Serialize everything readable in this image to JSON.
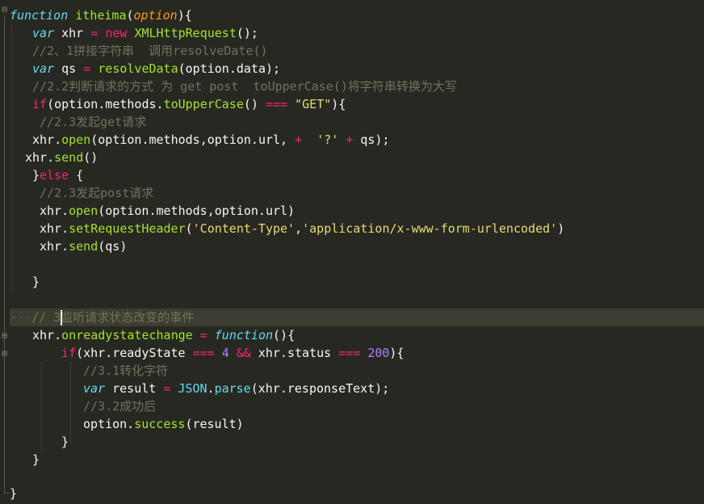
{
  "editor": {
    "theme": "monokai",
    "colors": {
      "background": "#272822",
      "keyword": "#f92672",
      "storage": "#66d9ef",
      "function": "#a6e22e",
      "string": "#e6db74",
      "number": "#ae81ff",
      "comment": "#75715e",
      "parameter": "#fd971f",
      "text": "#f8f8f2"
    },
    "lines": {
      "l1": {
        "kw": "function",
        "name": "itheima",
        "open": "(",
        "param": "option",
        "close": "){"
      },
      "l2": {
        "kw": "var",
        "a": " xhr ",
        "eq": "=",
        "new": "new",
        "cls": "XMLHttpRequest",
        "end": "();"
      },
      "l3": {
        "comment": "//2、1拼接字符串  调用resolveDate()"
      },
      "l4": {
        "kw": "var",
        "a": " qs ",
        "eq": "=",
        "fn": "resolveData",
        "end": "(option.data);"
      },
      "l5": {
        "comment": "//2.2判断请求的方式 为 get post  toUpperCase()将字符串转换为大写"
      },
      "l6": {
        "kw": "if",
        "a": "(option.methods.",
        "fn": "toUpperCase",
        "b": "() ",
        "op": "===",
        "c": " ",
        "str": "\"GET\"",
        "end": "){"
      },
      "l7": {
        "comment": "//2.3发起get请求"
      },
      "l8": {
        "a": "xhr.",
        "fn": "open",
        "b": "(option.methods,option.url, ",
        "op1": "+",
        "c": "  ",
        "str": "'?'",
        "d": " ",
        "op2": "+",
        "end": " qs);"
      },
      "l9": {
        "a": "xhr.",
        "fn": "send",
        "end": "()"
      },
      "l10": {
        "a": "}",
        "kw": "else",
        "end": " {"
      },
      "l11": {
        "comment": "//2.3发起post请求"
      },
      "l12": {
        "a": "xhr.",
        "fn": "open",
        "end": "(option.methods,option.url)"
      },
      "l13": {
        "a": "xhr.",
        "fn": "setRequestHeader",
        "b": "(",
        "str1": "'Content-Type'",
        "c": ",",
        "str2": "'application/x-www-form-urlencoded'",
        "end": ")"
      },
      "l14": {
        "a": "xhr.",
        "fn": "send",
        "end": "(qs)"
      },
      "l16": {
        "end": "}"
      },
      "l18": {
        "dots": "···",
        "comment_a": "// ",
        "comment_b": "3监听请求状态改变的事件"
      },
      "l19": {
        "a": "xhr.",
        "fn": "onreadystatechange",
        "b": " ",
        "eq": "=",
        "c": " ",
        "kw": "function",
        "end": "(){"
      },
      "l20": {
        "kw": "if",
        "a": "(xhr.readyState ",
        "op1": "===",
        "b": " ",
        "n1": "4",
        "c": " ",
        "op2": "&&",
        "d": " xhr.status ",
        "op3": "===",
        "e": " ",
        "n2": "200",
        "end": "){"
      },
      "l21": {
        "comment": "//3.1转化字符"
      },
      "l22": {
        "kw": "var",
        "a": " result ",
        "eq": "=",
        "b": " ",
        "obj": "JSON",
        "c": ".",
        "fn": "parse",
        "end": "(xhr.responseText);"
      },
      "l23": {
        "comment": "//3.2成功后"
      },
      "l24": {
        "a": "option.",
        "fn": "success",
        "end": "(result)"
      },
      "l25": {
        "end": "}"
      },
      "l26": {
        "end": "}"
      },
      "l28": {
        "end": "}"
      }
    }
  }
}
